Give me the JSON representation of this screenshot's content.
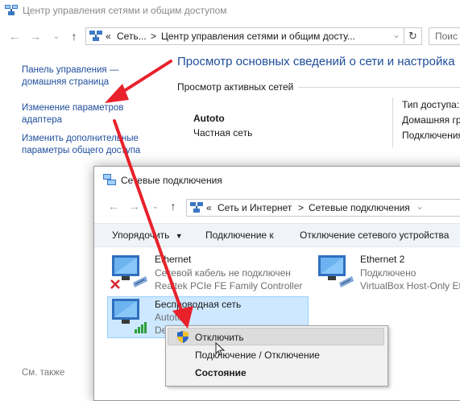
{
  "bg_window": {
    "title": "Центр управления сетями и общим доступом",
    "nav": {
      "back": "←",
      "forward": "→",
      "up": "↑",
      "refresh": "↻"
    },
    "address": {
      "chevron": "«",
      "segments": [
        "Сеть...",
        "Центр управления сетями и общим досту..."
      ],
      "separator": ">",
      "dropdown": "⌄"
    },
    "search_placeholder": "Поис",
    "sidebar": {
      "home_line1": "Панель управления —",
      "home_line2": "домашняя страница",
      "adapter_line1": "Изменение параметров",
      "adapter_line2": "адаптера",
      "sharing_line1": "Изменить дополнительные",
      "sharing_line2": "параметры общего доступа",
      "see_also": "См. также"
    },
    "main": {
      "heading": "Просмотр основных сведений о сети и настройка",
      "active_networks": "Просмотр активных сетей",
      "network_name": "Autoto",
      "network_type": "Частная сеть",
      "access_type_label": "Тип доступа:",
      "homegroup_label": "Домашняя гр",
      "connections_label": "Подключения"
    }
  },
  "fg_window": {
    "title": "Сетевые подключения",
    "nav": {
      "back": "←",
      "forward": "→",
      "up": "↑"
    },
    "address": {
      "chevron": "«",
      "segments": [
        "Сеть и Интернет",
        "Сетевые подключения"
      ],
      "separator": ">",
      "dropdown": "⌄"
    },
    "toolbar": {
      "organize": "Упорядочить",
      "organize_arrow": "▼",
      "connect": "Подключение к",
      "disable": "Отключение сетевого устройства"
    },
    "adapters": [
      {
        "name": "Ethernet",
        "status": "Сетевой кабель не подключен",
        "device": "Realtek PCIe FE Family Controller"
      },
      {
        "name": "Ethernet 2",
        "status": "Подключено",
        "device": "VirtualBox Host-Only Et"
      },
      {
        "name": "Беспроводная сеть",
        "status": "Autoto",
        "device": "De"
      }
    ]
  },
  "context_menu": {
    "items": [
      "Отключить",
      "Подключение / Отключение",
      "Состояние"
    ]
  },
  "colors": {
    "link": "#1f4e9c",
    "heading": "#1e4e9a",
    "selection": "#cde8ff",
    "arrow": "#e8212b",
    "error_x": "#d9262c"
  }
}
